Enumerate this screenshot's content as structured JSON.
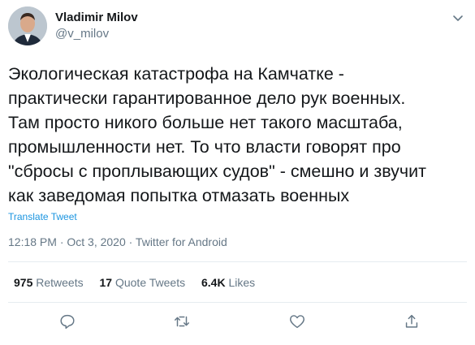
{
  "author": {
    "name": "Vladimir Milov",
    "handle": "@v_milov"
  },
  "tweet": {
    "text": "Экологическая катастрофа на Камчатке -\nпрактически гарантированное дело рук военных.\nТам просто никого больше нет такого масштаба,\nпромышленности нет. То что власти говорят про\n\"сбросы с проплывающих судов\" - смешно и звучит\nкак заведомая попытка отмазать военных",
    "translate_label": "Translate Tweet",
    "timestamp": "12:18 PM · Oct 3, 2020 · Twitter for Android"
  },
  "stats": {
    "retweets_count": "975",
    "retweets_label": "Retweets",
    "quotes_count": "17",
    "quotes_label": "Quote Tweets",
    "likes_count": "6.4K",
    "likes_label": "Likes"
  },
  "icons": {
    "reply": "reply-icon",
    "retweet": "retweet-icon",
    "like": "like-icon",
    "share": "share-icon",
    "more": "chevron-down-icon"
  },
  "colors": {
    "link": "#1b95e0",
    "secondary_text": "#657786",
    "divider": "#e6ecf0"
  }
}
